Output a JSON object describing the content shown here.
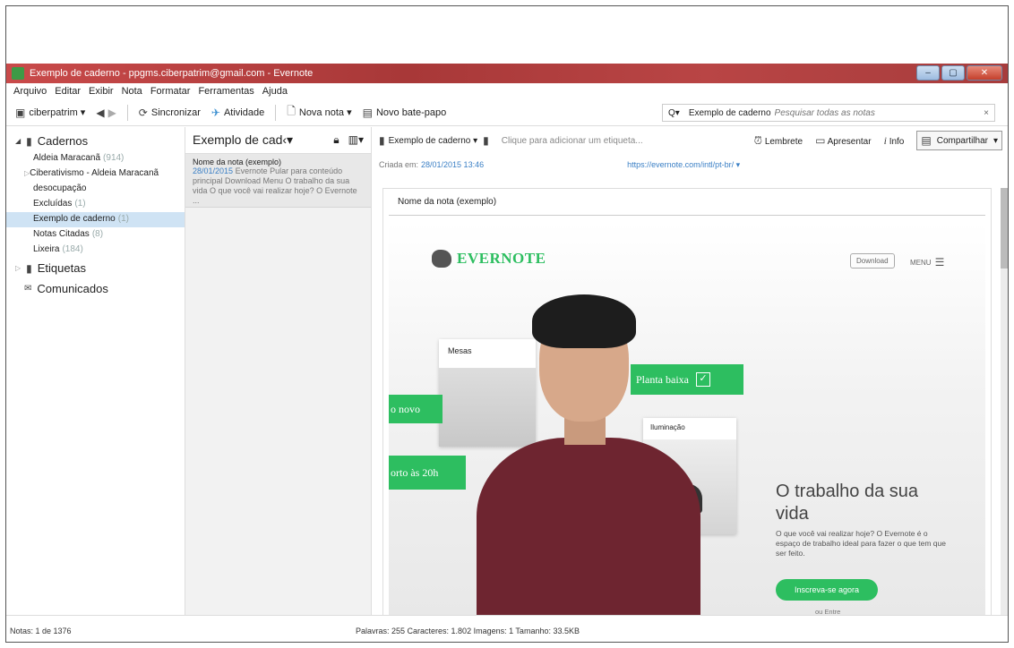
{
  "window": {
    "title": "Exemplo de caderno - ppgms.ciberpatrim@gmail.com - Evernote",
    "controls": [
      "–",
      "▢",
      "✕"
    ]
  },
  "menu": [
    "Arquivo",
    "Editar",
    "Exibir",
    "Nota",
    "Formatar",
    "Ferramentas",
    "Ajuda"
  ],
  "toolbar": {
    "account": "ciberpatrim ▾",
    "sync": "Sincronizar",
    "activity": "Atividade",
    "new_note": "Nova nota ▾",
    "new_chat": "Novo bate-papo",
    "search_prefix": "Q▾",
    "search_scope": "Exemplo de caderno",
    "search_placeholder": "Pesquisar todas as notas",
    "search_clear": "×"
  },
  "sidebar": {
    "notebooks_label": "Cadernos",
    "notebooks": [
      {
        "label": "Aldeia Maracanã",
        "count": "(914)",
        "selected": false
      },
      {
        "label": "Ciberativismo - Aldeia Maracanã",
        "count": "",
        "selected": false
      },
      {
        "label": "desocupação",
        "count": "",
        "selected": false
      },
      {
        "label": "Excluídas",
        "count": "(1)",
        "selected": false
      },
      {
        "label": "Exemplo de caderno",
        "count": "(1)",
        "selected": true
      },
      {
        "label": "Notas Citadas",
        "count": "(8)",
        "selected": false
      },
      {
        "label": "Lixeira",
        "count": "(184)",
        "selected": false
      }
    ],
    "tags_label": "Etiquetas",
    "communications_label": "Comunicados"
  },
  "note_list": {
    "header": "Exemplo de cad‹▾",
    "notes": [
      {
        "title": "Nome da nota (exemplo)",
        "date": "28/01/2015",
        "snippet": "Evernote Pular para conteúdo principal Download Menu O trabalho da sua vida O que você vai realizar hoje? O Evernote ..."
      }
    ]
  },
  "editor": {
    "notebook": "Exemplo de caderno ▾",
    "tag_placeholder": "Clique para adicionar um etiqueta...",
    "reminder": "Lembrete",
    "present": "Apresentar",
    "info": "Info",
    "share": "Compartilhar",
    "created_label": "Criada em:",
    "created_date": "28/01/2015 13:46",
    "source_url": "https://evernote.com/intl/pt-br/ ▾",
    "note_title": "Nome da nota (exemplo)"
  },
  "webpage": {
    "logo": "EVERNOTE",
    "download": "Download",
    "menu": "MENU",
    "card_mesas": "Mesas",
    "tag_planta": "Planta baixa",
    "tag_novo": "o novo",
    "card_iluminacao": "Iluminação",
    "tag_porto": "orto às 20h",
    "hero_title": "O trabalho da sua vida",
    "hero_subtitle": "O que você vai realizar hoje? O Evernote é o espaço de trabalho ideal para fazer o que tem que ser feito.",
    "hero_cta": "Inscreva-se agora",
    "hero_login": "ou Entre"
  },
  "status": {
    "left": "Notas: 1 de 1376",
    "right": "Palavras: 255   Caracteres: 1.802   Imagens: 1   Tamanho: 33.5KB"
  }
}
